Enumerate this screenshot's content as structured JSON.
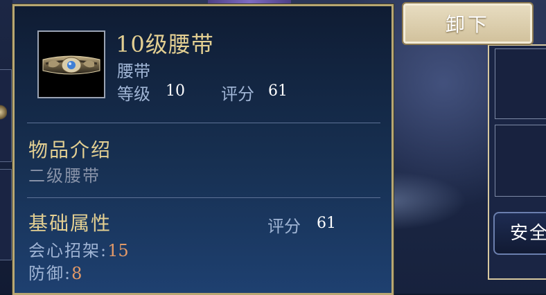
{
  "item": {
    "name": "10级腰带",
    "type": "腰带",
    "level_label": "等级",
    "level_value": "10",
    "score_label": "评分",
    "score_value": "61",
    "icon": "belt-icon"
  },
  "intro": {
    "title": "物品介绍",
    "description": "二级腰带"
  },
  "attributes": {
    "title": "基础属性",
    "score_label": "评分",
    "score_value": "61",
    "list": [
      {
        "name": "会心招架:",
        "value": "15"
      },
      {
        "name": "防御:",
        "value": "8"
      }
    ]
  },
  "actions": {
    "unequip_label": "卸下",
    "safe_label": "安全"
  },
  "colors": {
    "gold_text": "#e3cf92",
    "label_text": "#9fb4d4",
    "value_orange": "#e39a68",
    "panel_border": "#b8a772"
  }
}
